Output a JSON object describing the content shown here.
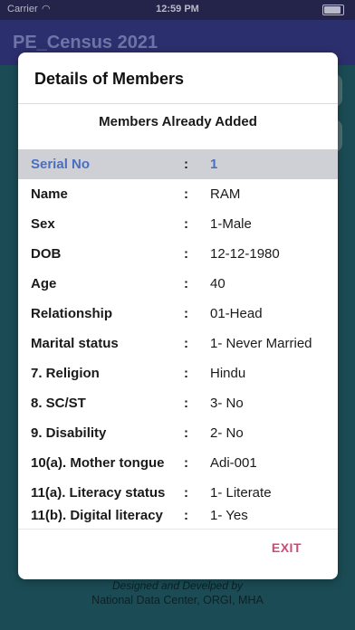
{
  "status_bar": {
    "carrier": "Carrier",
    "time": "12:59 PM"
  },
  "app": {
    "title": "PE_Census 2021"
  },
  "footer": {
    "line1": "Designed and Develped by",
    "line2": "National Data Center, ORGI, MHA"
  },
  "dialog": {
    "title": "Details of Members",
    "subtitle": "Members Already Added",
    "header_row": {
      "label": "Serial No",
      "value": "1"
    },
    "rows": [
      {
        "label": "Name",
        "value": "RAM"
      },
      {
        "label": "Sex",
        "value": "1-Male"
      },
      {
        "label": "DOB",
        "value": "12-12-1980"
      },
      {
        "label": "Age",
        "value": "40"
      },
      {
        "label": "Relationship",
        "value": "01-Head"
      },
      {
        "label": "Marital status",
        "value": "1- Never Married"
      },
      {
        "label": "7. Religion",
        "value": "Hindu"
      },
      {
        "label": "8. SC/ST",
        "value": "3- No"
      },
      {
        "label": "9. Disability",
        "value": "2- No"
      },
      {
        "label": "10(a). Mother tongue",
        "value": "Adi-001"
      },
      {
        "label": "11(a). Literacy status",
        "value": "1- Literate"
      },
      {
        "label": "11(b). Digital literacy",
        "value": "1- Yes"
      }
    ],
    "separator": ":",
    "exit_label": "EXIT"
  }
}
